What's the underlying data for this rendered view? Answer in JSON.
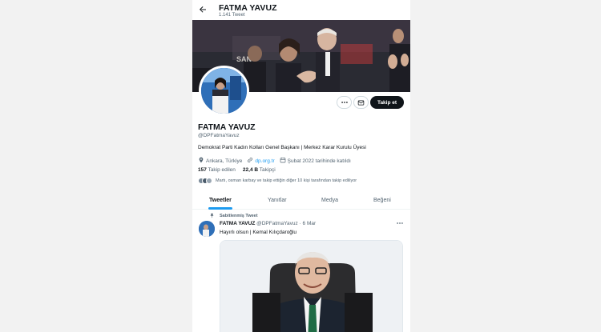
{
  "header": {
    "back_icon": "arrow-left-icon",
    "name": "FATMA YAVUZ",
    "tweet_count": "1.141 Tweet"
  },
  "profile": {
    "name": "FATMA YAVUZ",
    "handle": "@DPFatmaYavuz",
    "bio": "Demokrat Parti Kadın Kolları Genel Başkanı | Merkez Karar Kurulu Üyesi",
    "location": "Ankara, Türkiye",
    "website": "dp.org.tr",
    "joined": "Şubat 2022 tarihinde katıldı",
    "following_count": "157",
    "following_label": "Takip edilen",
    "followers_count": "22,4 B",
    "followers_label": "Takipçi",
    "followed_by": "Martı, osman karbay ve takip ettiğin diğer 10 kişi tarafından takip ediliyor"
  },
  "actions": {
    "more_icon": "more-horizontal-icon",
    "message_icon": "mail-icon",
    "follow_label": "Takip et"
  },
  "tabs": [
    {
      "label": "Tweetler",
      "active": true
    },
    {
      "label": "Yanıtlar",
      "active": false
    },
    {
      "label": "Medya",
      "active": false
    },
    {
      "label": "Beğeni",
      "active": false
    }
  ],
  "pinned_tweet": {
    "pinned_label": "Sabitlenmiş Tweet",
    "author": "FATMA YAVUZ",
    "handle": "@DPFatmaYavuz",
    "date": "· 6 Mar",
    "text": "Hayırlı olsun | Kemal Kılıçdaroğlu"
  },
  "colors": {
    "accent": "#1d9bf0",
    "follow_button": "#0f1419"
  }
}
